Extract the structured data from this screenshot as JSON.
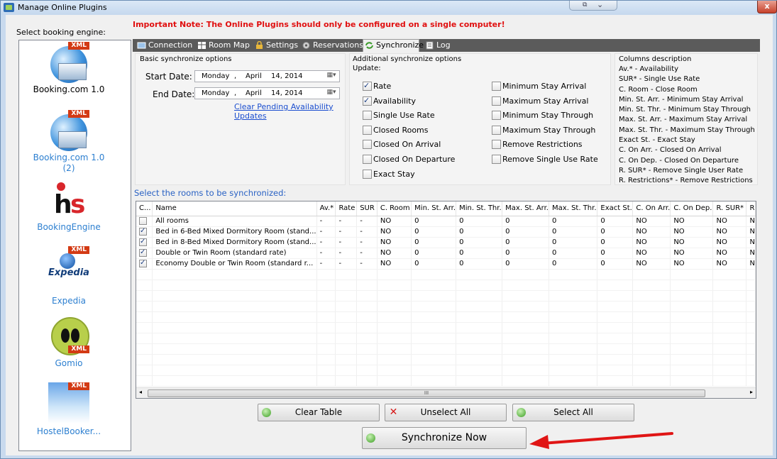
{
  "window": {
    "title": "Manage Online Plugins",
    "close_glyph": "x"
  },
  "left_panel": {
    "label": "Select booking engine:",
    "engines": [
      {
        "name": "Booking.com 1.0",
        "icon": "xml-globe-box-icon",
        "badge": "XML"
      },
      {
        "name": "Booking.com 1.0",
        "sub": "(2)",
        "icon": "xml-globe-box-icon",
        "badge": "XML"
      },
      {
        "name": "BookingEngine",
        "icon": "hs-logo-icon",
        "logo_text_h": "h",
        "logo_text_s": "s"
      },
      {
        "name": "Expedia",
        "icon": "expedia-logo-icon",
        "logo_text": "Expedia",
        "badge": "XML"
      },
      {
        "name": "Gomio",
        "icon": "gomio-logo-icon",
        "badge": "XML"
      },
      {
        "name": "HostelBooker...",
        "icon": "hostelbooker-logo-icon",
        "badge": "XML"
      }
    ]
  },
  "note": "Important Note: The Online Plugins should only be configured on a single computer!",
  "tabs": [
    {
      "label": "Connection",
      "icon": "connection-icon"
    },
    {
      "label": "Room Map",
      "icon": "room-map-icon"
    },
    {
      "label": "Settings",
      "icon": "settings-icon"
    },
    {
      "label": "Reservations",
      "icon": "reservations-icon"
    },
    {
      "label": "Synchronize",
      "icon": "synchronize-icon",
      "active": true
    },
    {
      "label": "Log",
      "icon": "log-icon"
    }
  ],
  "basic": {
    "title": "Basic synchronize options",
    "start_label": "Start Date:",
    "end_label": "End Date:",
    "start": {
      "day": "Monday",
      "sep": ",",
      "month": "April",
      "date": "14, 2014"
    },
    "end": {
      "day": "Monday",
      "sep": ",",
      "month": "April",
      "date": "14, 2014"
    },
    "clear_link": "Clear Pending Availability Updates"
  },
  "additional": {
    "title": "Additional synchronize options",
    "update_label": "Update:",
    "left_options": [
      {
        "label": "Rate",
        "checked": true
      },
      {
        "label": "Availability",
        "checked": true
      },
      {
        "label": "Single Use Rate",
        "checked": false
      },
      {
        "label": "Closed Rooms",
        "checked": false
      },
      {
        "label": "Closed On Arrival",
        "checked": false
      },
      {
        "label": "Closed On Departure",
        "checked": false
      },
      {
        "label": "Exact Stay",
        "checked": false
      }
    ],
    "right_options": [
      {
        "label": "Minimum Stay Arrival",
        "checked": false
      },
      {
        "label": "Maximum Stay Arrival",
        "checked": false
      },
      {
        "label": "Minimum Stay Through",
        "checked": false
      },
      {
        "label": "Maximum Stay Through",
        "checked": false
      },
      {
        "label": "Remove Restrictions",
        "checked": false
      },
      {
        "label": "Remove Single Use Rate",
        "checked": false
      }
    ]
  },
  "columns_desc": {
    "title": "Columns description",
    "lines": [
      "Av.* - Availability",
      "SUR* - Single Use Rate",
      "C. Room - Close Room",
      "Min. St. Arr. - Minimum Stay Arrival",
      "Min. St. Thr. - Minimum Stay Through",
      "Max. St. Arr. - Maximum Stay Arrival",
      "Max. St. Thr. - Maximum Stay Through",
      "Exact St. - Exact Stay",
      "C. On Arr. - Closed On Arrival",
      "C. On Dep. - Closed On Departure",
      "R. SUR* - Remove Single User Rate",
      "R. Restrictions* - Remove Restrictions"
    ]
  },
  "rooms": {
    "label": "Select the rooms to be synchronized:",
    "headers": [
      "C...",
      "Name",
      "Av.*",
      "Rate",
      "SUR",
      "C. Room",
      "Min. St. Arr.",
      "Min. St. Thr.",
      "Max. St. Arr.",
      "Max. St. Thr.",
      "Exact St.",
      "C. On Arr.",
      "C. On Dep.",
      "R. SUR*",
      "R"
    ],
    "rows": [
      {
        "checked": false,
        "cells": [
          "All rooms",
          "-",
          "-",
          "-",
          "NO",
          "0",
          "0",
          "0",
          "0",
          "0",
          "NO",
          "NO",
          "NO",
          "N"
        ]
      },
      {
        "checked": true,
        "cells": [
          "Bed in 6-Bed Mixed Dormitory Room (stand...",
          "-",
          "-",
          "-",
          "NO",
          "0",
          "0",
          "0",
          "0",
          "0",
          "NO",
          "NO",
          "NO",
          "N"
        ]
      },
      {
        "checked": true,
        "cells": [
          "Bed in 8-Bed Mixed Dormitory Room (stand...",
          "-",
          "-",
          "-",
          "NO",
          "0",
          "0",
          "0",
          "0",
          "0",
          "NO",
          "NO",
          "NO",
          "N"
        ]
      },
      {
        "checked": true,
        "cells": [
          "Double or Twin Room (standard rate)",
          "-",
          "-",
          "-",
          "NO",
          "0",
          "0",
          "0",
          "0",
          "0",
          "NO",
          "NO",
          "NO",
          "N"
        ]
      },
      {
        "checked": true,
        "cells": [
          "Economy Double or Twin Room (standard r...",
          "-",
          "-",
          "-",
          "NO",
          "0",
          "0",
          "0",
          "0",
          "0",
          "NO",
          "NO",
          "NO",
          "N"
        ]
      }
    ],
    "scroll_grip": "III"
  },
  "buttons": {
    "clear_table": "Clear Table",
    "unselect_all": "Unselect All",
    "select_all": "Select All",
    "synchronize_now": "Synchronize Now"
  },
  "colors": {
    "note_red": "#e01010",
    "link_blue": "#1a4dcf",
    "tabstrip": "#5b5b5b",
    "annotation_arrow": "#e01515"
  }
}
